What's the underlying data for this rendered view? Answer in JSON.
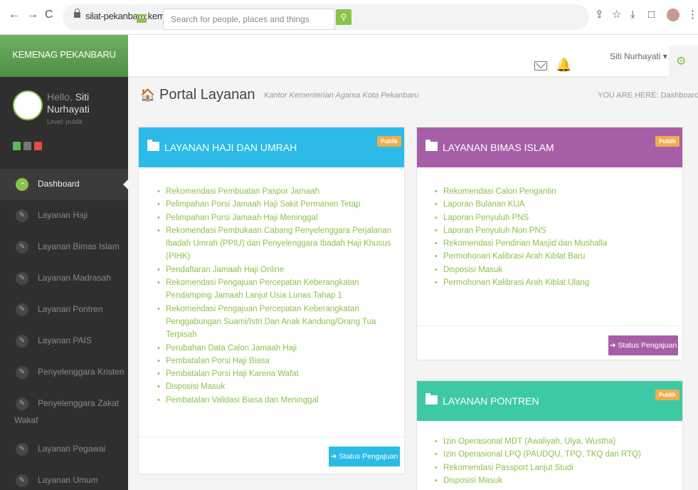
{
  "browser": {
    "back": "←",
    "forward": "→",
    "reload": "C",
    "url": "silat-pekanbaru.kemenag.go.id/publik/dashboard/index",
    "share": "⇪",
    "star": "☆",
    "download": "⤓",
    "window": "□",
    "more": "⋮"
  },
  "topbar": {
    "brand": "KEMENAG PEKANBARU",
    "search_placeholder": "Search for people, places and things",
    "search_glyph": "⚲",
    "bell_glyph": "🔔",
    "user": "Siti Nurhayati ▾",
    "gear_glyph": "⚙"
  },
  "profile": {
    "greeting": "Hello,",
    "first_name": "Siti",
    "last_name": "Nurhayati",
    "level": "Level: publik",
    "colors": {
      "user_btn": "#5cb85c",
      "settings_btn": "#777777",
      "power_btn": "#e74c3c"
    }
  },
  "sidebar": {
    "items": [
      {
        "label": "Dashboard",
        "icon": "dashboard-icon"
      },
      {
        "label": "Layanan Haji",
        "icon": "pencil-icon"
      },
      {
        "label": "Layanan Bimas Islam",
        "icon": "pencil-icon"
      },
      {
        "label": "Layanan Madrasah",
        "icon": "pencil-icon"
      },
      {
        "label": "Layanan Pontren",
        "icon": "pencil-icon"
      },
      {
        "label": "Layanan PAIS",
        "icon": "pencil-icon"
      },
      {
        "label": "Penyelenggara Kristen",
        "icon": "pencil-icon"
      },
      {
        "label": "Penyelenggara Zakat",
        "label2": "Wakaf",
        "icon": "pencil-icon"
      },
      {
        "label": "Layanan Pegawai",
        "icon": "pencil-icon"
      },
      {
        "label": "Layanan Umum",
        "icon": "pencil-icon"
      }
    ]
  },
  "header": {
    "home_glyph": "🏠",
    "title": "Portal Layanan",
    "subtitle": "Kantor Kementerian Agama Kota Pekanbaru",
    "breadcrumb": "YOU ARE HERE:  Dashboard"
  },
  "panels": {
    "haji": {
      "title": "LAYANAN HAJI DAN UMRAH",
      "badge": "Publik",
      "color": "#2bbbe6",
      "items": [
        "Rekomendasi Pembuatan Paspor Jamaah",
        "Pelimpahan Porsi Jamaah Haji Sakit Permanen Tetap",
        "Pelimpahan Porsi Jamaah Haji Meninggal",
        "Rekomendasi Pembukaan Cabang Penyelenggara Perjalanan Ibadah Umrah (PPIU) dan Penyelenggara Ibadah Haji Khusus (PIHK)",
        "Pendaftaran Jamaah Haji Online",
        "Rekomendasi Pengajuan Percepatan Keberangkatan Pendamping Jamaah Lanjut Usia Lunas Tahap 1",
        "Rekomendasi Pengajuan Percepatan Keberangkatan Penggabungan Suami/Istri Dan Anak Kandung/Orang Tua Terpisah",
        "Perubahan Data Calon Jamaah Haji",
        "Pembatalan Porsi Haji Biasa",
        "Pembatalan Porsi Haji Karena Wafat",
        "Disposisi Masuk",
        "Pembatalan Validasi Biasa dan Meninggal"
      ],
      "button": "Status Pengajuan"
    },
    "bimas": {
      "title": "LAYANAN BIMAS ISLAM",
      "badge": "Publik",
      "color": "#a65fa6",
      "items": [
        "Rekomendasi Calon Pengantin",
        "Laporan Bulanan KUA",
        "Laporan Penyuluh PNS",
        "Laporan Penyuluh Non PNS",
        "Rekomendasi Pendirian Masjid dan Mushalla",
        "Permohonan Kalibrasi Arah Kiblat Baru",
        "Disposisi Masuk",
        "Permohonan Kalibrasi Arah Kiblat Ulang"
      ],
      "button": "Status Pengajuan"
    },
    "pontren": {
      "title": "LAYANAN PONTREN",
      "badge": "Publik",
      "color": "#3ec9a5",
      "items": [
        "Izin Operasional MDT (Awaliyah, Ulya, Wustha)",
        "Izin Operasional LPQ (PAUDQU, TPQ, TKQ dan RTQ)",
        "Rekomendasi Passport Lanjut Studi",
        "Disposisi Masuk"
      ]
    }
  }
}
